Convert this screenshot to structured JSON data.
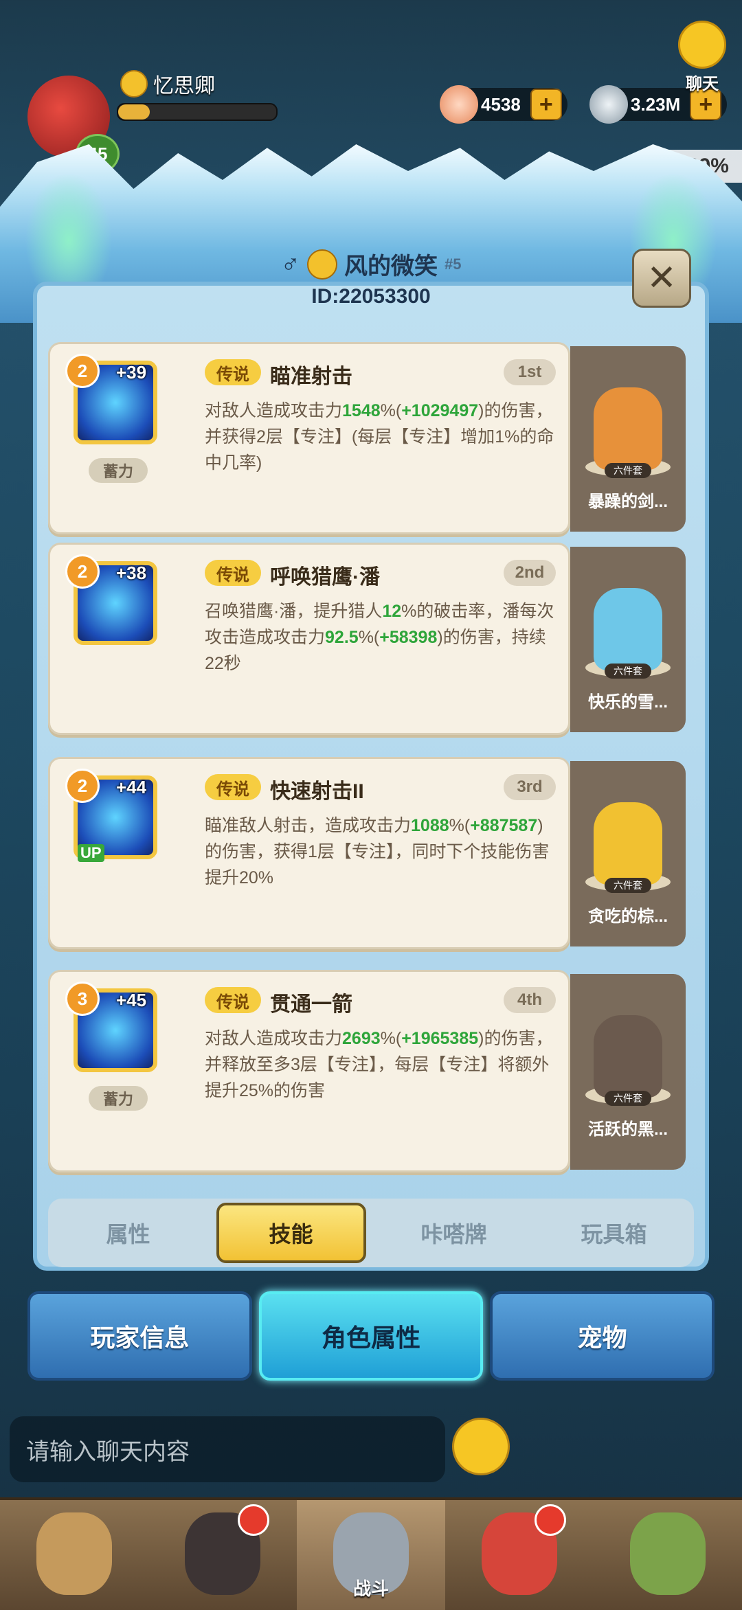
{
  "hud": {
    "nickname": "忆思卿",
    "level": "45",
    "shells": "4538",
    "pearls": "3.23M",
    "percent": "99.99%",
    "chat": "聊天"
  },
  "player": {
    "gender_icon": "male-icon",
    "name": "风的微笑",
    "rank": "#5",
    "id": "ID:22053300"
  },
  "skills": [
    {
      "level": "2",
      "bonus": "+39",
      "rarity": "传说",
      "name": "瞄准射击",
      "order": "1st",
      "tag": "蓄力",
      "desc": [
        {
          "t": "对敌人造成攻击力"
        },
        {
          "t": "1548",
          "g": 1
        },
        {
          "t": "%("
        },
        {
          "t": "+1029497",
          "g": 1
        },
        {
          "t": ")的伤害，并获得2层【专注】(每层【专注】增加1%的命中几率)"
        }
      ]
    },
    {
      "level": "2",
      "bonus": "+38",
      "rarity": "传说",
      "name": "呼唤猎鹰·潘",
      "order": "2nd",
      "tag": "",
      "desc": [
        {
          "t": "召唤猎鹰·潘，提升猎人"
        },
        {
          "t": "12",
          "g": 1
        },
        {
          "t": "%的破击率，潘每次攻击造成攻击力"
        },
        {
          "t": "92.5",
          "g": 1
        },
        {
          "t": "%("
        },
        {
          "t": "+58398",
          "g": 1
        },
        {
          "t": ")的伤害，持续22秒"
        }
      ]
    },
    {
      "level": "2",
      "bonus": "+44",
      "rarity": "传说",
      "name": "快速射击II",
      "order": "3rd",
      "tag": "",
      "up": "UP",
      "desc": [
        {
          "t": "瞄准敌人射击，造成攻击力"
        },
        {
          "t": "1088",
          "g": 1
        },
        {
          "t": "%("
        },
        {
          "t": "+887587",
          "g": 1
        },
        {
          "t": ")的伤害，获得1层【专注】，同时下个技能伤害提升20%"
        }
      ]
    },
    {
      "level": "3",
      "bonus": "+45",
      "rarity": "传说",
      "name": "贯通一箭",
      "order": "4th",
      "tag": "蓄力",
      "desc": [
        {
          "t": "对敌人造成攻击力"
        },
        {
          "t": "2693",
          "g": 1
        },
        {
          "t": "%("
        },
        {
          "t": "+1965385",
          "g": 1
        },
        {
          "t": ")的伤害，并释放至多3层【专注】，每层【专注】将额外提升25%的伤害"
        }
      ]
    }
  ],
  "pets": [
    {
      "set": "六件套",
      "name": "暴躁的剑...",
      "color": "#e7913a"
    },
    {
      "set": "六件套",
      "name": "快乐的雪...",
      "color": "#6ec7e8"
    },
    {
      "set": "六件套",
      "name": "贪吃的棕...",
      "color": "#f1c131"
    },
    {
      "set": "六件套",
      "name": "活跃的黑...",
      "color": "#6b5a4e"
    }
  ],
  "tabs": [
    "属性",
    "技能",
    "咔嗒牌",
    "玩具箱"
  ],
  "active_tab": 1,
  "big_tabs": [
    "玩家信息",
    "角色属性",
    "宠物"
  ],
  "active_big_tab": 1,
  "chat_input": {
    "placeholder": "请输入聊天内容"
  },
  "bottom_nav": {
    "active_label": "战斗"
  }
}
